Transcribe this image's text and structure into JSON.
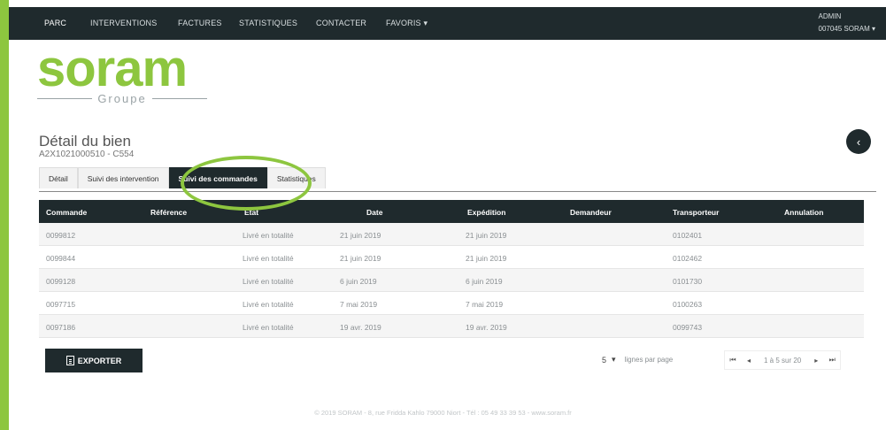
{
  "nav": {
    "items": [
      "PARC",
      "INTERVENTIONS",
      "FACTURES",
      "STATISTIQUES",
      "CONTACTER",
      "FAVORIS ▾"
    ],
    "user_role": "ADMIN",
    "user_account": "007045 SORAM ▾"
  },
  "logo": {
    "brand": "soram",
    "group": "Groupe"
  },
  "page": {
    "title": "Détail du bien",
    "subtitle": "A2X1021000510 - C554",
    "back_icon": "chevron-left-icon"
  },
  "tabs": [
    "Détail",
    "Suivi des intervention",
    "Suivi des commandes",
    "Statistiques"
  ],
  "table": {
    "headers": [
      "Commande",
      "Référence",
      "Etat",
      "Date",
      "Expédition",
      "Demandeur",
      "Transporteur",
      "Annulation"
    ],
    "rows": [
      [
        "0099812",
        "",
        "Livré en totalité",
        "21 juin 2019",
        "21 juin 2019",
        "",
        "0102401",
        ""
      ],
      [
        "0099844",
        "",
        "Livré en totalité",
        "21 juin 2019",
        "21 juin 2019",
        "",
        "0102462",
        ""
      ],
      [
        "0099128",
        "",
        "Livré en totalité",
        "6 juin 2019",
        "6 juin 2019",
        "",
        "0101730",
        ""
      ],
      [
        "0097715",
        "",
        "Livré en totalité",
        "7 mai 2019",
        "7 mai 2019",
        "",
        "0100263",
        ""
      ],
      [
        "0097186",
        "",
        "Livré en totalité",
        "19 avr. 2019",
        "19 avr. 2019",
        "",
        "0099743",
        ""
      ]
    ]
  },
  "export_label": "EXPORTER",
  "pager": {
    "rows_value": "5",
    "rows_caret": "▾",
    "rows_label": "lignes par page",
    "first": "⏮",
    "prev": "◂",
    "info": "1 à 5 sur 20",
    "next": "▸",
    "last": "⏭"
  },
  "footer": "© 2019 SORAM - 8, rue Fridda Kahlo 79000 Niort - Tél : 05 49 33 39 53 - www.soram.fr",
  "colors": {
    "accent": "#8dc63f",
    "dark": "#1f2a2d"
  }
}
